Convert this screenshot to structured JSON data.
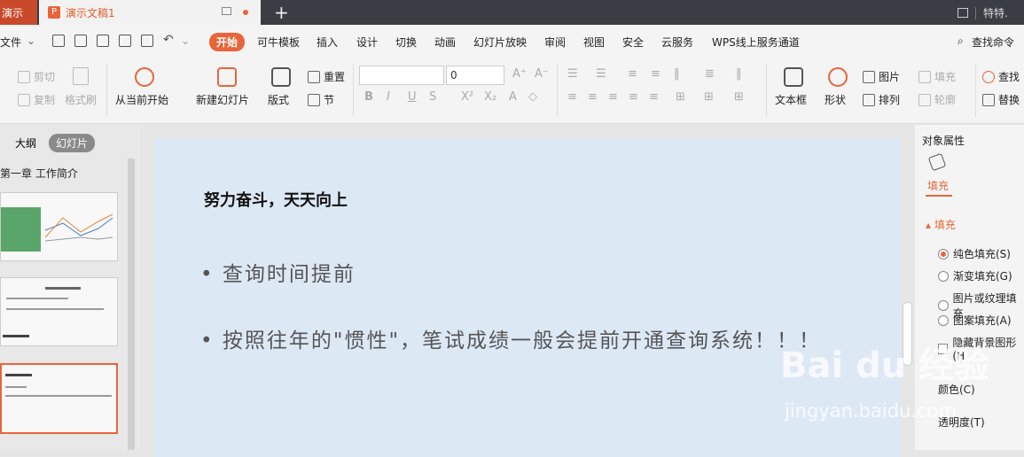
{
  "titlebar": {
    "app_tab": "演示",
    "doc_tab": "演示文稿1",
    "new_tab": "+",
    "user": "特特."
  },
  "menubar": {
    "file": "文件",
    "tabs": [
      "开始",
      "可牛模板",
      "插入",
      "设计",
      "切换",
      "动画",
      "幻灯片放映",
      "审阅",
      "视图",
      "安全",
      "云服务",
      "WPS线上服务通道"
    ],
    "search": "查找命令"
  },
  "ribbon": {
    "cut": "剪切",
    "copy": "复制",
    "format_painter": "格式刷",
    "from_current": "从当前开始",
    "new_slide": "新建幻灯片",
    "layout": "版式",
    "reset": "重置",
    "section": "节",
    "font_size": "0",
    "text_box": "文本框",
    "shape": "形状",
    "picture": "图片",
    "fill": "填充",
    "arrange": "排列",
    "outline": "轮廓",
    "find": "查找",
    "replace": "替换"
  },
  "left_panel": {
    "tab_outline": "大纲",
    "tab_slides": "幻灯片",
    "chapter_title": "第一章 工作简介"
  },
  "slide": {
    "title": "努力奋斗，天天向上",
    "bullets": [
      "查询时间提前",
      "按照往年的\"惯性\"，笔试成绩一般会提前开通查询系统！！！"
    ]
  },
  "right_panel": {
    "title": "对象属性",
    "tab_fill": "填充",
    "section": "填充",
    "options": [
      "纯色填充(S)",
      "渐变填充(G)",
      "图片或纹理填充",
      "图案填充(A)"
    ],
    "hide_bg": "隐藏背景图形(H",
    "color": "颜色(C)",
    "transparency": "透明度(T)"
  },
  "watermark": {
    "text": "Bai du 经验",
    "url": "jingyan.baidu.com"
  },
  "colors": {
    "accent": "#e8653a",
    "slide_bg": "#dde8f5"
  }
}
